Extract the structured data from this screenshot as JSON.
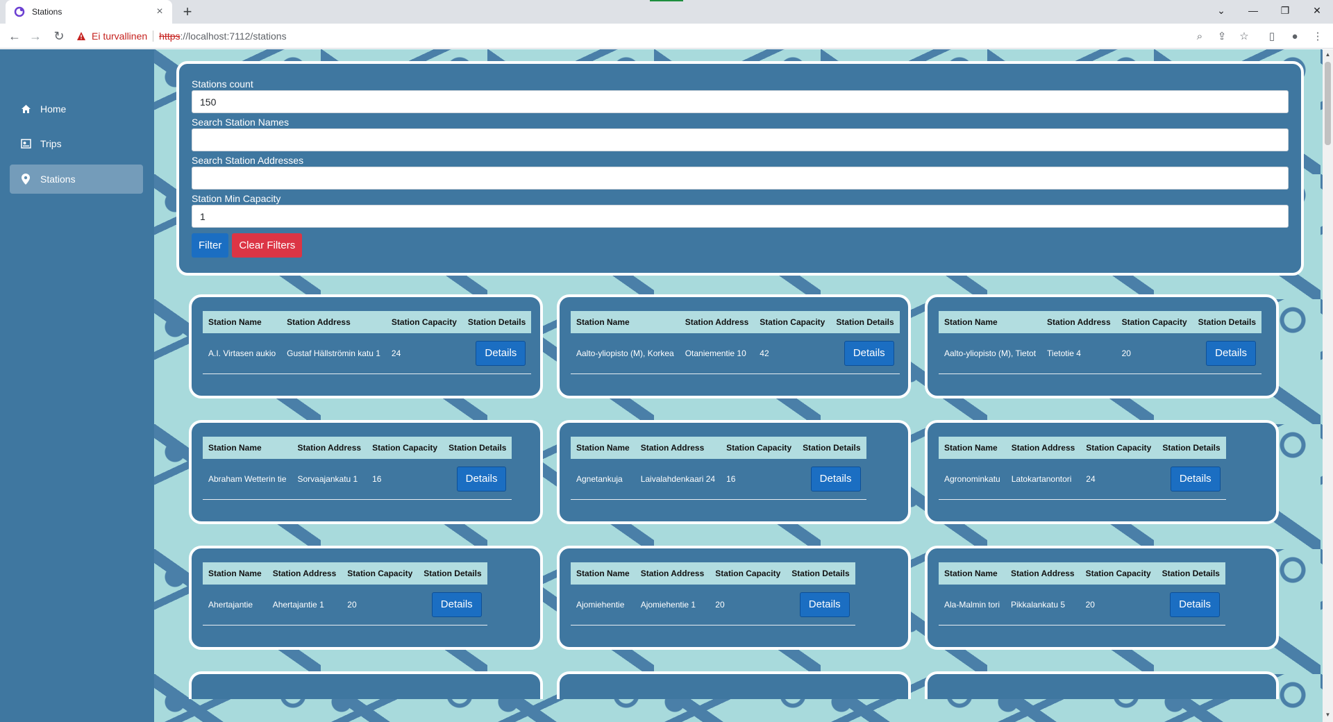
{
  "browser": {
    "tab_title": "Stations",
    "new_tab_label": "+",
    "security_label": "Ei turvallinen",
    "url_scheme": "https",
    "url_rest": "://localhost:7112/stations"
  },
  "sidebar": {
    "items": [
      {
        "label": "Home",
        "icon": "home-icon"
      },
      {
        "label": "Trips",
        "icon": "trips-icon"
      },
      {
        "label": "Stations",
        "icon": "location-pin-icon",
        "active": true
      }
    ]
  },
  "filters": {
    "count_label": "Stations count",
    "count_value": "150",
    "names_label": "Search Station Names",
    "names_value": "",
    "addresses_label": "Search Station Addresses",
    "addresses_value": "",
    "capacity_label": "Station Min Capacity",
    "capacity_value": "1",
    "filter_button": "Filter",
    "clear_button": "Clear Filters"
  },
  "table_headers": [
    "Station Name",
    "Station Address",
    "Station Capacity",
    "Station Details"
  ],
  "details_label": "Details",
  "stations": [
    {
      "name": "A.I. Virtasen aukio",
      "address": "Gustaf Hällströmin katu 1",
      "capacity": "24"
    },
    {
      "name": "Aalto-yliopisto (M), Korkea",
      "address": "Otaniementie 10",
      "capacity": "42"
    },
    {
      "name": "Aalto-yliopisto (M), Tietot",
      "address": "Tietotie 4",
      "capacity": "20"
    },
    {
      "name": "Abraham Wetterin tie",
      "address": "Sorvaajankatu 1",
      "capacity": "16"
    },
    {
      "name": "Agnetankuja",
      "address": "Laivalahdenkaari 24",
      "capacity": "16"
    },
    {
      "name": "Agronominkatu",
      "address": "Latokartanontori",
      "capacity": "24"
    },
    {
      "name": "Ahertajantie",
      "address": "Ahertajantie 1",
      "capacity": "20"
    },
    {
      "name": "Ajomiehentie",
      "address": "Ajomiehentie 1",
      "capacity": "20"
    },
    {
      "name": "Ala-Malmin tori",
      "address": "Pikkalankatu 5",
      "capacity": "20"
    }
  ],
  "colors": {
    "sidebar": "#3f77a0",
    "background": "#a8dadc",
    "primary": "#1b6ec2",
    "danger": "#dc3545"
  }
}
